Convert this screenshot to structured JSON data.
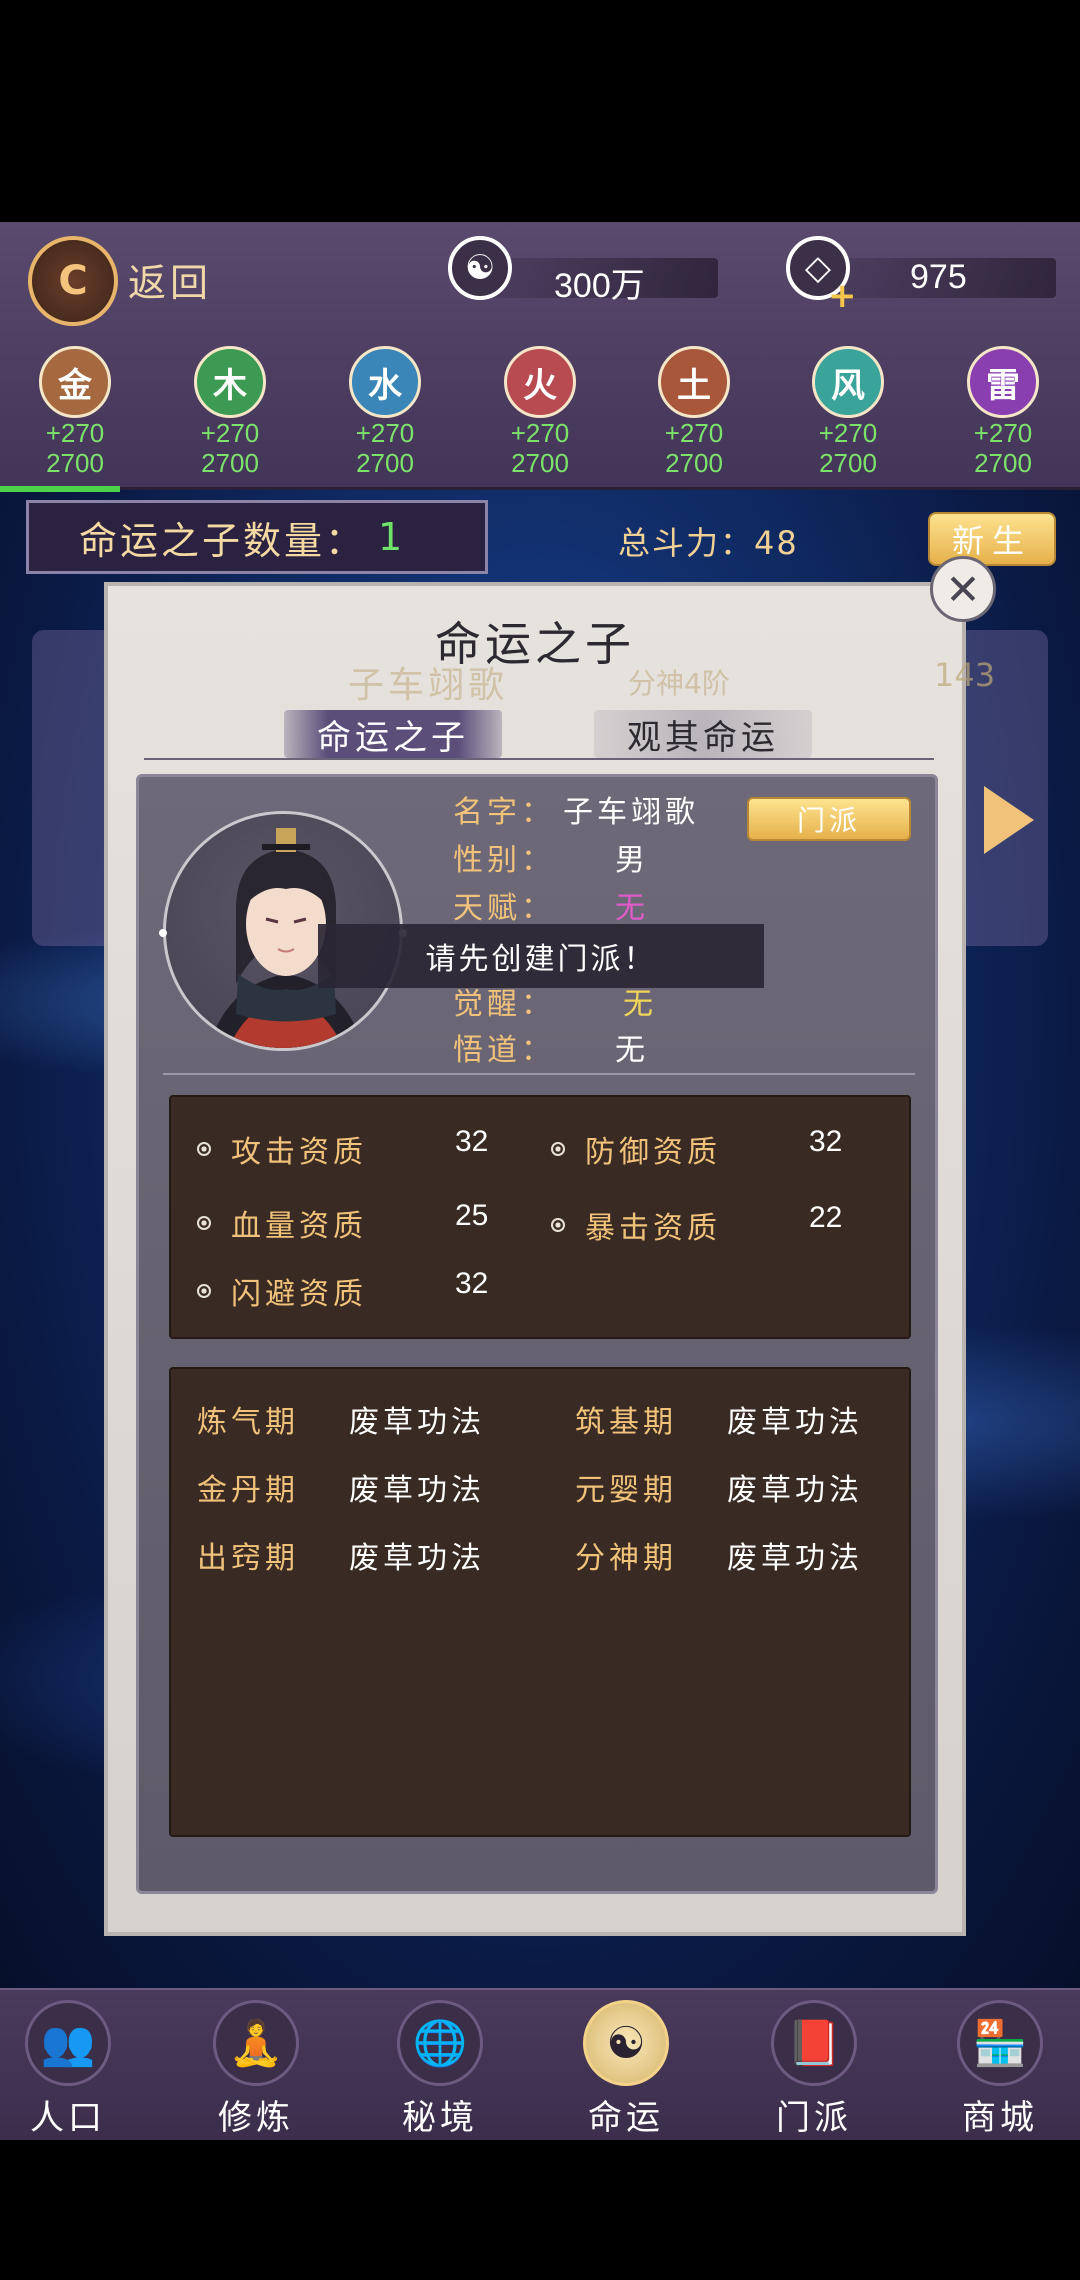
{
  "header": {
    "back_label": "返回",
    "silver_value": "300万",
    "gem_value": "975"
  },
  "elements": [
    {
      "name": "金",
      "plus": "+270",
      "total": "2700",
      "color": "#a5683f"
    },
    {
      "name": "木",
      "plus": "+270",
      "total": "2700",
      "color": "#3c9a52"
    },
    {
      "name": "水",
      "plus": "+270",
      "total": "2700",
      "color": "#3a86b8"
    },
    {
      "name": "火",
      "plus": "+270",
      "total": "2700",
      "color": "#b84a52"
    },
    {
      "name": "土",
      "plus": "+270",
      "total": "2700",
      "color": "#a8573a"
    },
    {
      "name": "风",
      "plus": "+270",
      "total": "2700",
      "color": "#3aa39a"
    },
    {
      "name": "雷",
      "plus": "+270",
      "total": "2700",
      "color": "#8a3fb0"
    }
  ],
  "summary": {
    "count_label": "命运之子数量：",
    "count_value": "1",
    "power_label": "总斗力：",
    "power_value": "48",
    "newborn_label": "新生"
  },
  "background_card": {
    "name": "子车翊歌",
    "rank": "分神4阶",
    "num": "143"
  },
  "modal": {
    "title": "命运之子",
    "close_icon": "close-icon",
    "tabs": [
      {
        "label": "命运之子",
        "active": true
      },
      {
        "label": "观其命运",
        "active": false
      }
    ],
    "profile": {
      "name_label": "名字：",
      "name_value": "子车翊歌",
      "gender_label": "性别：",
      "gender_value": "男",
      "talent_label": "天赋：",
      "talent_value": "无",
      "awaken_label": "觉醒：",
      "awaken_value": "无",
      "enlight_label": "悟道：",
      "enlight_value": "无",
      "sect_button": "门派"
    },
    "toast": "请先创建门派！",
    "stats": [
      {
        "label": "攻击资质",
        "value": "32"
      },
      {
        "label": "防御资质",
        "value": "32"
      },
      {
        "label": "血量资质",
        "value": "25"
      },
      {
        "label": "暴击资质",
        "value": "22"
      },
      {
        "label": "闪避资质",
        "value": "32"
      }
    ],
    "techniques": [
      {
        "stage": "炼气期",
        "skill": "废草功法"
      },
      {
        "stage": "筑基期",
        "skill": "废草功法"
      },
      {
        "stage": "金丹期",
        "skill": "废草功法"
      },
      {
        "stage": "元婴期",
        "skill": "废草功法"
      },
      {
        "stage": "出窍期",
        "skill": "废草功法"
      },
      {
        "stage": "分神期",
        "skill": "废草功法"
      }
    ]
  },
  "nav": [
    {
      "label": "人口",
      "icon": "people-icon",
      "active": false
    },
    {
      "label": "修炼",
      "icon": "meditate-icon",
      "active": false
    },
    {
      "label": "秘境",
      "icon": "globe-icon",
      "active": false
    },
    {
      "label": "命运",
      "icon": "yin-yang-icon",
      "active": true
    },
    {
      "label": "门派",
      "icon": "book-icon",
      "active": false
    },
    {
      "label": "商城",
      "icon": "shop-icon",
      "active": false
    }
  ]
}
